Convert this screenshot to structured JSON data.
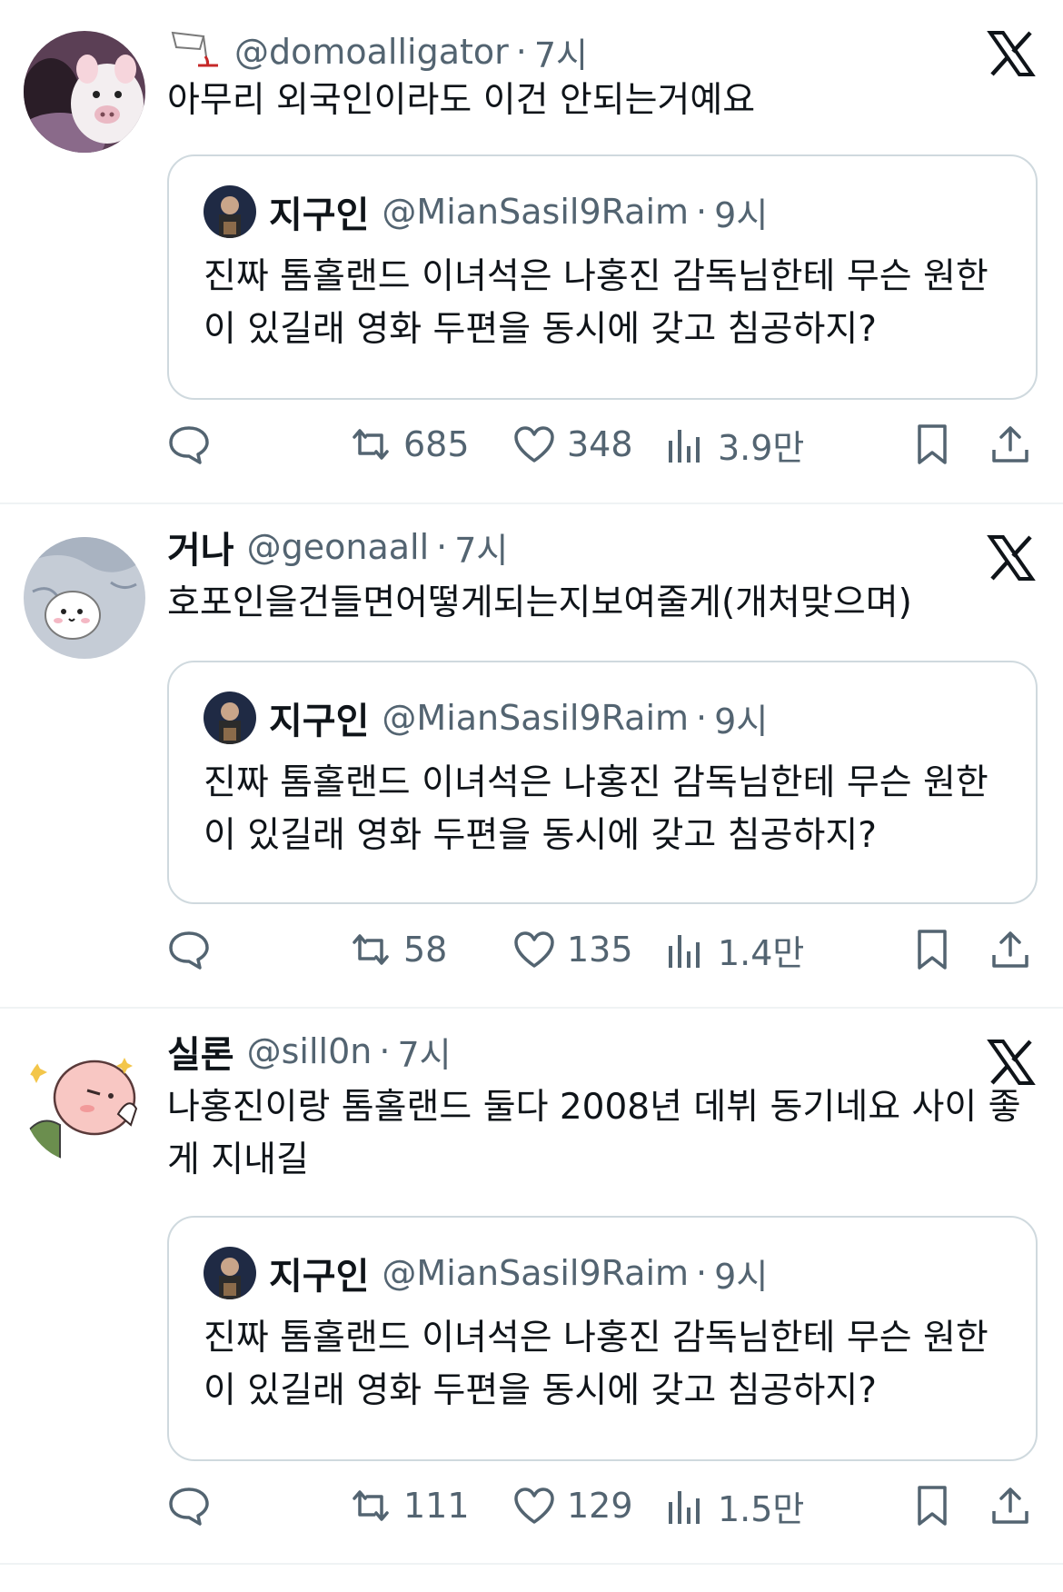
{
  "tweets": [
    {
      "name": "",
      "handle": "@domoalligator",
      "separator": "·",
      "time": "7시",
      "name_icon": "wine-glass-icon",
      "avatar": "pig-avatar",
      "text": "아무리 외국인이라도 이건 안되는거예요",
      "quote": {
        "name": "지구인",
        "handle": "@MianSasil9Raim",
        "separator": "·",
        "time": "9시",
        "text": "진짜 톰홀랜드 이녀석은 나홍진 감독님한테 무슨 원한이 있길래 영화 두편을 동시에 갖고 침공하지?"
      },
      "actions": {
        "reply": "",
        "retweets": "685",
        "likes": "348",
        "views": "3.9만"
      }
    },
    {
      "name": "거나",
      "handle": "@geonaall",
      "separator": "·",
      "time": "7시",
      "avatar": "hamster-avatar",
      "text": "호포인을건들면어떻게되는지보여줄게(개처맞으며)",
      "quote": {
        "name": "지구인",
        "handle": "@MianSasil9Raim",
        "separator": "·",
        "time": "9시",
        "text": "진짜 톰홀랜드 이녀석은 나홍진 감독님한테 무슨 원한이 있길래 영화 두편을 동시에 갖고 침공하지?"
      },
      "actions": {
        "reply": "",
        "retweets": "58",
        "likes": "135",
        "views": "1.4만"
      }
    },
    {
      "name": "실론",
      "handle": "@sill0n",
      "separator": "·",
      "time": "7시",
      "avatar": "peach-character-avatar",
      "text": "나홍진이랑 톰홀랜드 둘다 2008년 데뷔 동기네요 사이 좋게 지내길",
      "quote": {
        "name": "지구인",
        "handle": "@MianSasil9Raim",
        "separator": "·",
        "time": "9시",
        "text": "진짜 톰홀랜드 이녀석은 나홍진 감독님한테 무슨 원한이 있길래 영화 두편을 동시에 갖고 침공하지?"
      },
      "actions": {
        "reply": "",
        "retweets": "111",
        "likes": "129",
        "views": "1.5만"
      }
    }
  ],
  "colors": {
    "text": "#0f1419",
    "muted": "#536471",
    "border": "#cfd9de",
    "divider": "#eff3f4"
  }
}
